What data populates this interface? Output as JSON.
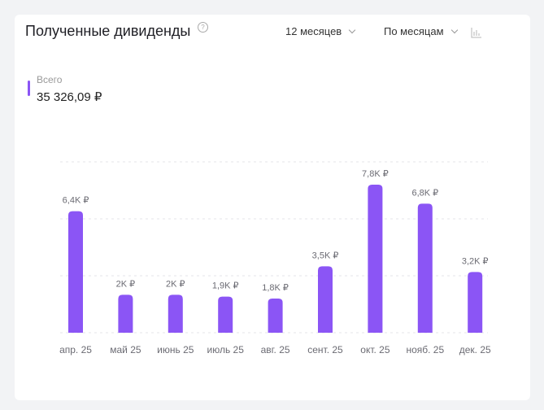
{
  "header": {
    "title": "Полученные дивиденды",
    "help": "?",
    "period": "12 месяцев",
    "grouping": "По месяцам"
  },
  "summary": {
    "label": "Всего",
    "total": "35 326,09 ₽"
  },
  "colors": {
    "bar": "#8b55f5"
  },
  "chart_data": {
    "type": "bar",
    "categories": [
      "апр. 25",
      "май 25",
      "июнь 25",
      "июль 25",
      "авг. 25",
      "сент. 25",
      "окт. 25",
      "нояб. 25",
      "дек. 25"
    ],
    "values": [
      6.4,
      2.0,
      2.0,
      1.9,
      1.8,
      3.5,
      7.8,
      6.8,
      3.2
    ],
    "labels": [
      "6,4K ₽",
      "2K ₽",
      "2K ₽",
      "1,9K ₽",
      "1,8K ₽",
      "3,5K ₽",
      "7,8K ₽",
      "6,8K ₽",
      "3,2K ₽"
    ],
    "unit": "K ₽",
    "ylim": [
      0,
      9
    ],
    "gridlines": [
      0,
      3,
      6,
      9
    ],
    "grid": true
  }
}
